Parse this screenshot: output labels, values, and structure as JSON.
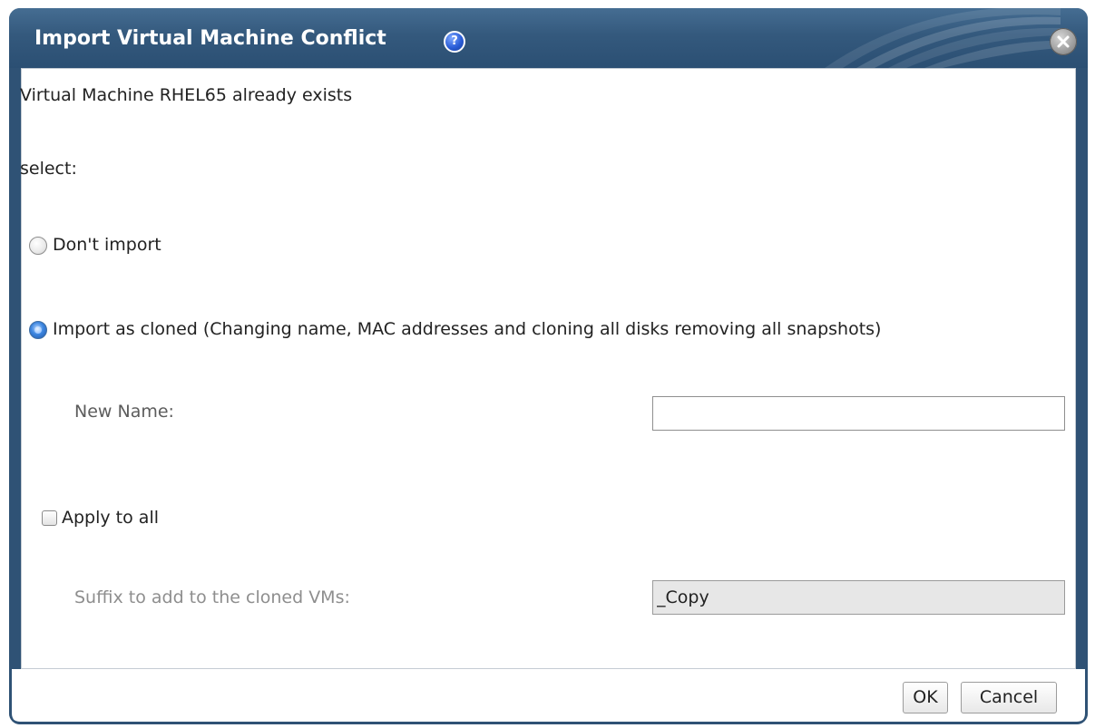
{
  "dialog": {
    "title": "Import Virtual Machine Conflict",
    "help_icon": "help-icon",
    "help_glyph": "?",
    "close_icon": "close-icon",
    "colors": {
      "titlebar": "#2f5275",
      "accent_radio": "#3d86e0"
    }
  },
  "body": {
    "message": "Virtual Machine RHEL65 already exists",
    "select_label": "select:",
    "options": [
      {
        "label": "Don't import",
        "selected": false
      },
      {
        "label": "Import as cloned (Changing name, MAC addresses and cloning all disks removing all snapshots)",
        "selected": true
      }
    ],
    "new_name_label": "New Name:",
    "new_name_value": "",
    "apply_to_all_label": "Apply to all",
    "apply_to_all_checked": false,
    "suffix_label": "Suffix to add to the cloned VMs:",
    "suffix_value": "_Copy"
  },
  "footer": {
    "ok_label": "OK",
    "cancel_label": "Cancel"
  }
}
